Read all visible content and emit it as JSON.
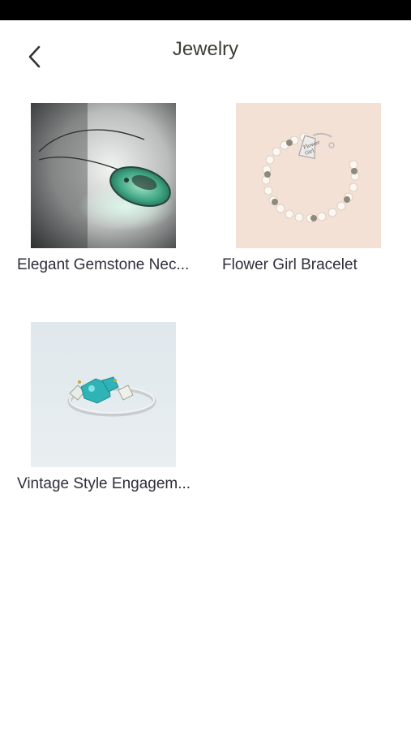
{
  "status_bar": {},
  "header": {
    "back_icon": "chevron-left-icon",
    "title": "Jewelry"
  },
  "products": [
    {
      "name": "Elegant Gemstone Nec...",
      "image": "green-glass-pendant-necklace"
    },
    {
      "name": "Flower Girl Bracelet",
      "image": "pearl-bracelet-with-heart-charm"
    },
    {
      "name": "Vintage Style Engagem...",
      "image": "turquoise-stone-silver-ring"
    }
  ],
  "colors": {
    "status_bar": "#000000",
    "title_text": "#3d3d33",
    "caption_text": "#2e2e3a",
    "background": "#ffffff"
  }
}
